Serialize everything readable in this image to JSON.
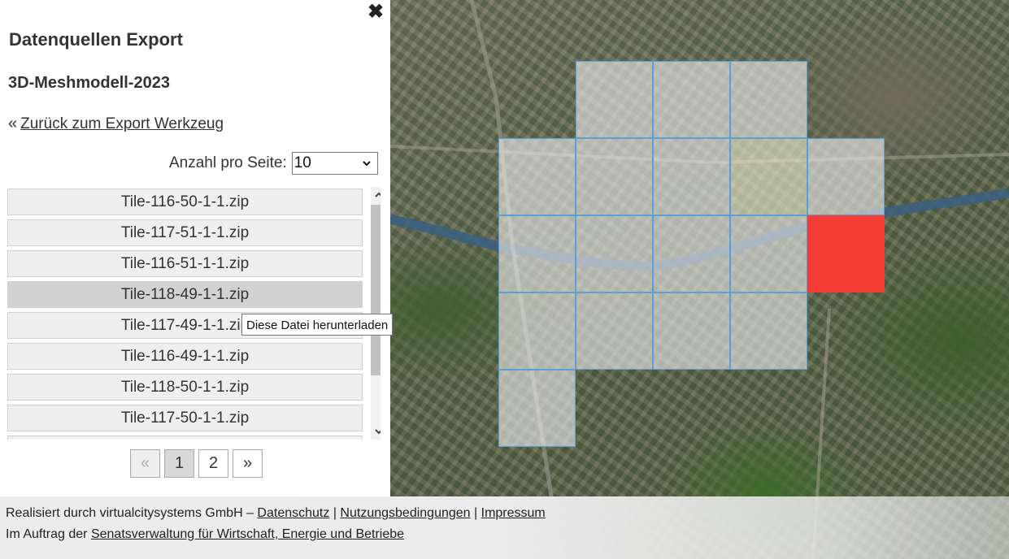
{
  "panel": {
    "close_glyph": "✖",
    "title": "Datenquellen Export",
    "subtitle": "3D-Meshmodell-2023",
    "back_arrow": "«",
    "back_label": "Zurück zum Export Werkzeug",
    "per_page_label": "Anzahl pro Seite:",
    "per_page_value": "10",
    "files": [
      "Tile-116-50-1-1.zip",
      "Tile-117-51-1-1.zip",
      "Tile-116-51-1-1.zip",
      "Tile-118-49-1-1.zip",
      "Tile-117-49-1-1.zip",
      "Tile-116-49-1-1.zip",
      "Tile-118-50-1-1.zip",
      "Tile-117-50-1-1.zip"
    ],
    "hovered_file_index": 3,
    "tooltip": "Diese Datei herunterladen",
    "pagination": {
      "prev": "«",
      "pages": [
        "1",
        "2"
      ],
      "next": "»",
      "current": "1"
    }
  },
  "footer": {
    "line1_prefix": "Realisiert durch virtualcitysystems GmbH –",
    "links1": [
      "Datenschutz",
      "Nutzungsbedingungen",
      "Impressum"
    ],
    "separator": "|",
    "line2_prefix": "Im Auftrag der",
    "line2_link": "Senatsverwaltung für Wirtschaft, Energie und Betriebe"
  },
  "map": {
    "tile_color": "#eeeeee",
    "tile_border_color": "#5aa0d6",
    "selected_tile_color": "#f33d35"
  }
}
